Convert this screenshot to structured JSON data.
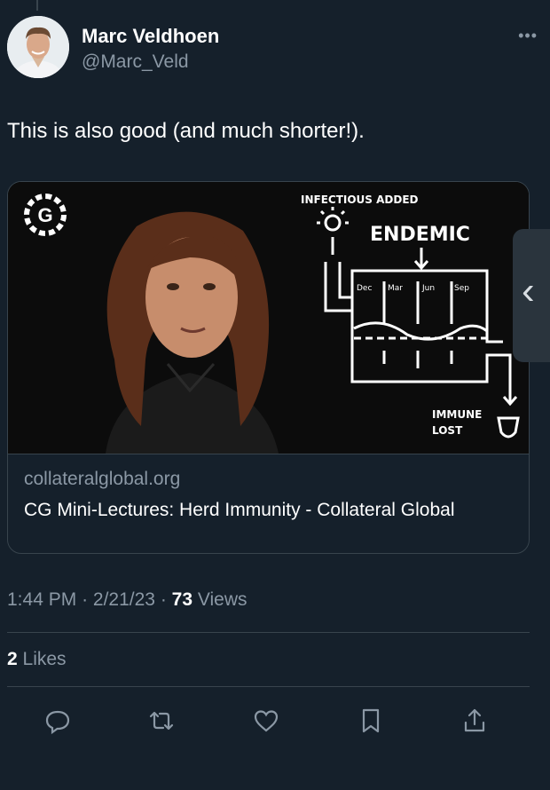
{
  "tweet": {
    "author": {
      "name": "Marc Veldhoen",
      "handle": "@Marc_Veld"
    },
    "more_label": "•••",
    "text": "This is also good (and much shorter!).",
    "card": {
      "overlay": {
        "logo_letter": "G",
        "infectious_added": "INFECTIOUS ADDED",
        "endemic": "ENDEMIC",
        "months": [
          "Dec",
          "Mar",
          "Jun",
          "Sep"
        ],
        "immune_lost_1": "IMMUNE",
        "immune_lost_2": "LOST"
      },
      "domain": "collateralglobal.org",
      "title": "CG Mini-Lectures: Herd Immunity - Collateral Global"
    },
    "meta": {
      "time": "1:44 PM",
      "date": "2/21/23",
      "sep": "·",
      "views_count": "73",
      "views_label": "Views"
    },
    "likes": {
      "count": "2",
      "label": "Likes"
    }
  },
  "side_handle": {
    "icon": "chevron-left-icon"
  },
  "actions": [
    "reply-icon",
    "retweet-icon",
    "like-icon",
    "bookmark-icon",
    "share-icon"
  ],
  "colors": {
    "background": "#15202b",
    "secondary_text": "#8b98a5",
    "border": "#38444d"
  }
}
